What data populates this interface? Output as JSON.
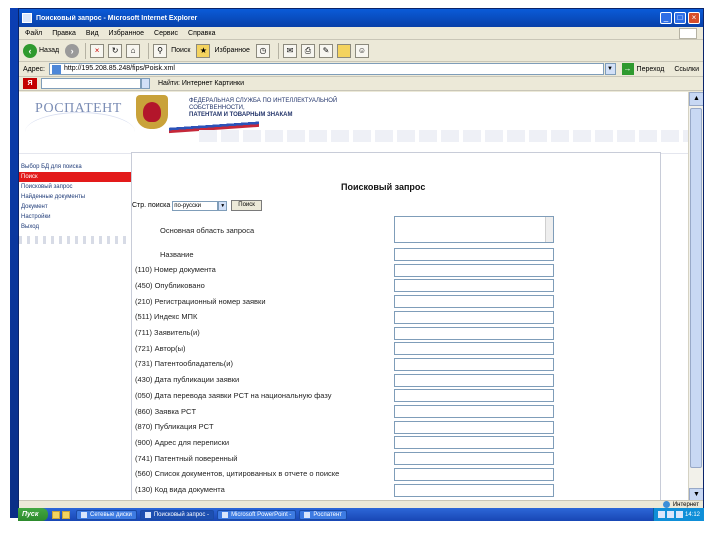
{
  "window": {
    "title": "Поисковый запрос - Microsoft Internet Explorer"
  },
  "menubar": {
    "items": [
      "Файл",
      "Правка",
      "Вид",
      "Избранное",
      "Сервис",
      "Справка"
    ]
  },
  "toolbar": {
    "back_label": "Назад",
    "search_label": "Поиск",
    "favorites_label": "Избранное"
  },
  "addressbar": {
    "label": "Адрес:",
    "url": "http://195.208.85.248/fips/Poisk.xml",
    "go_label": "Переход",
    "links_label": "Ссылки"
  },
  "searchbar": {
    "logo": "Я",
    "text": "Найти: Интернет  Картинки"
  },
  "site": {
    "logo": "РОСПАТЕНТ",
    "subtitle_line1": "ФЕДЕРАЛЬНАЯ СЛУЖБА ПО ИНТЕЛЛЕКТУАЛЬНОЙ СОБСТВЕННОСТИ,",
    "subtitle_line2": "ПАТЕНТАМ И ТОВАРНЫМ ЗНАКАМ"
  },
  "nav": {
    "items": [
      {
        "label": "Выбор БД для поиска",
        "active": false
      },
      {
        "label": "Поиск",
        "active": true
      },
      {
        "label": "Поисковый запрос",
        "active": false
      },
      {
        "label": "Найденные документы",
        "active": false
      },
      {
        "label": "Документ",
        "active": false
      },
      {
        "label": "Настройки",
        "active": false
      },
      {
        "label": "Выход",
        "active": false
      }
    ]
  },
  "form": {
    "title": "Поисковый запрос",
    "language_label": "Стр. поиска",
    "language_value": "по-русски",
    "language_button": "Поиск",
    "main_field_label": "Основная область запроса",
    "fields": [
      "Название",
      "(110) Номер документа",
      "(450) Опубликовано",
      "(210) Регистрационный номер заявки",
      "(511) Индекс МПК",
      "(711) Заявитель(и)",
      "(721) Автор(ы)",
      "(731) Патентообладатель(и)",
      "(430) Дата публикации заявки",
      "(050) Дата перевода заявки PCT на национальную фазу",
      "(860) Заявка PCT",
      "(870) Публикация PCT",
      "(900) Адрес для переписки",
      "(741) Патентный поверенный",
      "(560) Список документов, цитированных в отчете о поиске",
      "(130) Код вида документа"
    ]
  },
  "statusbar": {
    "zone": "Интернет"
  },
  "taskbar": {
    "start_label": "Пуск",
    "tasks": [
      {
        "label": "Сетевые диски",
        "active": false
      },
      {
        "label": "Поисковый запрос -",
        "active": true
      },
      {
        "label": "Microsoft PowerPoint -",
        "active": false
      },
      {
        "label": "Роспатент",
        "active": false
      }
    ],
    "clock": "14:12"
  }
}
